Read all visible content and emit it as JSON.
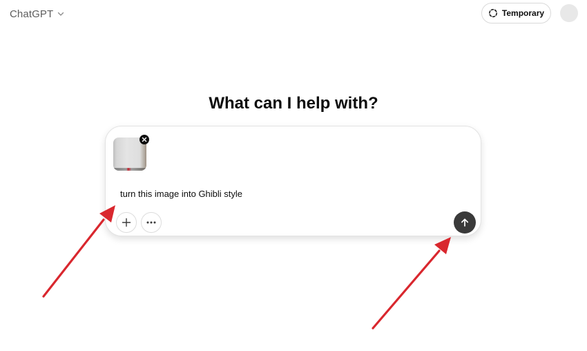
{
  "header": {
    "model_name": "ChatGPT",
    "temporary_label": "Temporary"
  },
  "main": {
    "heading": "What can I help with?"
  },
  "composer": {
    "prompt_text": "turn this image into Ghibli style",
    "attachment_icon": "image-thumbnail",
    "add_icon": "plus-icon",
    "more_icon": "ellipsis-icon",
    "send_icon": "arrow-up-icon"
  },
  "annotations": {
    "arrow_color": "#d9272e"
  },
  "colors": {
    "send_button": "#3a3a3a",
    "avatar": "#e8e8e8"
  }
}
